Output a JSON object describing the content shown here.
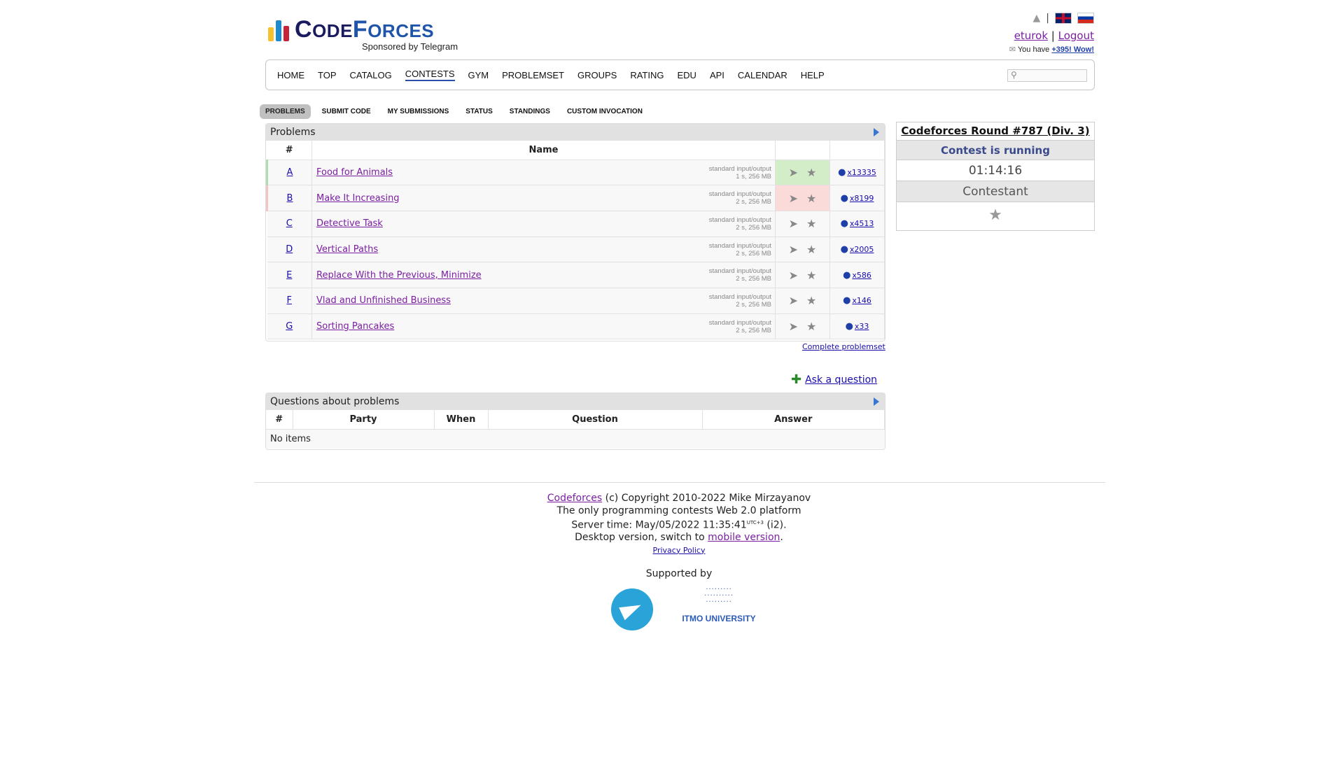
{
  "header": {
    "logo_text_first": "C",
    "logo_text_rest": "ODE",
    "logo_text_second": "F",
    "logo_text_second_rest": "ORCES",
    "sponsor": "Sponsored by Telegram",
    "user": "eturok",
    "sep": "|",
    "logout": "Logout",
    "msg_prefix": "You have",
    "msg_link": "+395! Wow!"
  },
  "nav": {
    "items": [
      "HOME",
      "TOP",
      "CATALOG",
      "CONTESTS",
      "GYM",
      "PROBLEMSET",
      "GROUPS",
      "RATING",
      "EDU",
      "API",
      "CALENDAR",
      "HELP"
    ],
    "active": "CONTESTS",
    "search_placeholder": ""
  },
  "subtabs": {
    "items": [
      "PROBLEMS",
      "SUBMIT CODE",
      "MY SUBMISSIONS",
      "STATUS",
      "STANDINGS",
      "CUSTOM INVOCATION"
    ],
    "active": "PROBLEMS"
  },
  "problems": {
    "header": "Problems",
    "col_num": "#",
    "col_name": "Name",
    "rows": [
      {
        "letter": "A",
        "name": "Food for Animals",
        "io": "standard input/output",
        "limits": "1 s, 256 MB",
        "solved": "x13335",
        "state": "ok"
      },
      {
        "letter": "B",
        "name": "Make It Increasing",
        "io": "standard input/output",
        "limits": "2 s, 256 MB",
        "solved": "x8199",
        "state": "bad"
      },
      {
        "letter": "C",
        "name": "Detective Task",
        "io": "standard input/output",
        "limits": "2 s, 256 MB",
        "solved": "x4513",
        "state": ""
      },
      {
        "letter": "D",
        "name": "Vertical Paths",
        "io": "standard input/output",
        "limits": "2 s, 256 MB",
        "solved": "x2005",
        "state": ""
      },
      {
        "letter": "E",
        "name": "Replace With the Previous, Minimize",
        "io": "standard input/output",
        "limits": "2 s, 256 MB",
        "solved": "x586",
        "state": ""
      },
      {
        "letter": "F",
        "name": "Vlad and Unfinished Business",
        "io": "standard input/output",
        "limits": "2 s, 256 MB",
        "solved": "x146",
        "state": ""
      },
      {
        "letter": "G",
        "name": "Sorting Pancakes",
        "io": "standard input/output",
        "limits": "2 s, 256 MB",
        "solved": "x33",
        "state": ""
      }
    ],
    "complete_link": "Complete problemset"
  },
  "ask": {
    "label": "Ask a question"
  },
  "questions": {
    "header": "Questions about problems",
    "cols": [
      "#",
      "Party",
      "When",
      "Question",
      "Answer"
    ],
    "empty": "No items"
  },
  "sidebar": {
    "title": "Codeforces Round #787 (Div. 3)",
    "status": "Contest is running",
    "timer": "01:14:16",
    "role": "Contestant"
  },
  "footer": {
    "cf_link": "Codeforces",
    "copyright": "(c) Copyright 2010-2022 Mike Mirzayanov",
    "tagline": "The only programming contests Web 2.0 platform",
    "server_time_label": "Server time:",
    "server_time": "May/05/2022 11:35:41",
    "tz": "UTC+3",
    "server_suffix": "(i2).",
    "desktop_text": "Desktop version, switch to",
    "mobile_link": "mobile version",
    "privacy": "Privacy Policy",
    "supported_by": "Supported by",
    "itmo": "ITMO UNIVERSITY"
  },
  "colors": {
    "accepted_bg": "#d4edc9",
    "rejected_bg": "#fbdada",
    "link": "#1a0dab",
    "visited": "#7b1fa2"
  },
  "icons": [
    "bell-icon",
    "uk-flag-icon",
    "ru-flag-icon",
    "envelope-icon",
    "search-icon",
    "send-icon",
    "star-icon",
    "user-icon",
    "arrow-right-icon",
    "ask-question-icon",
    "telegram-logo",
    "itmo-logo"
  ]
}
